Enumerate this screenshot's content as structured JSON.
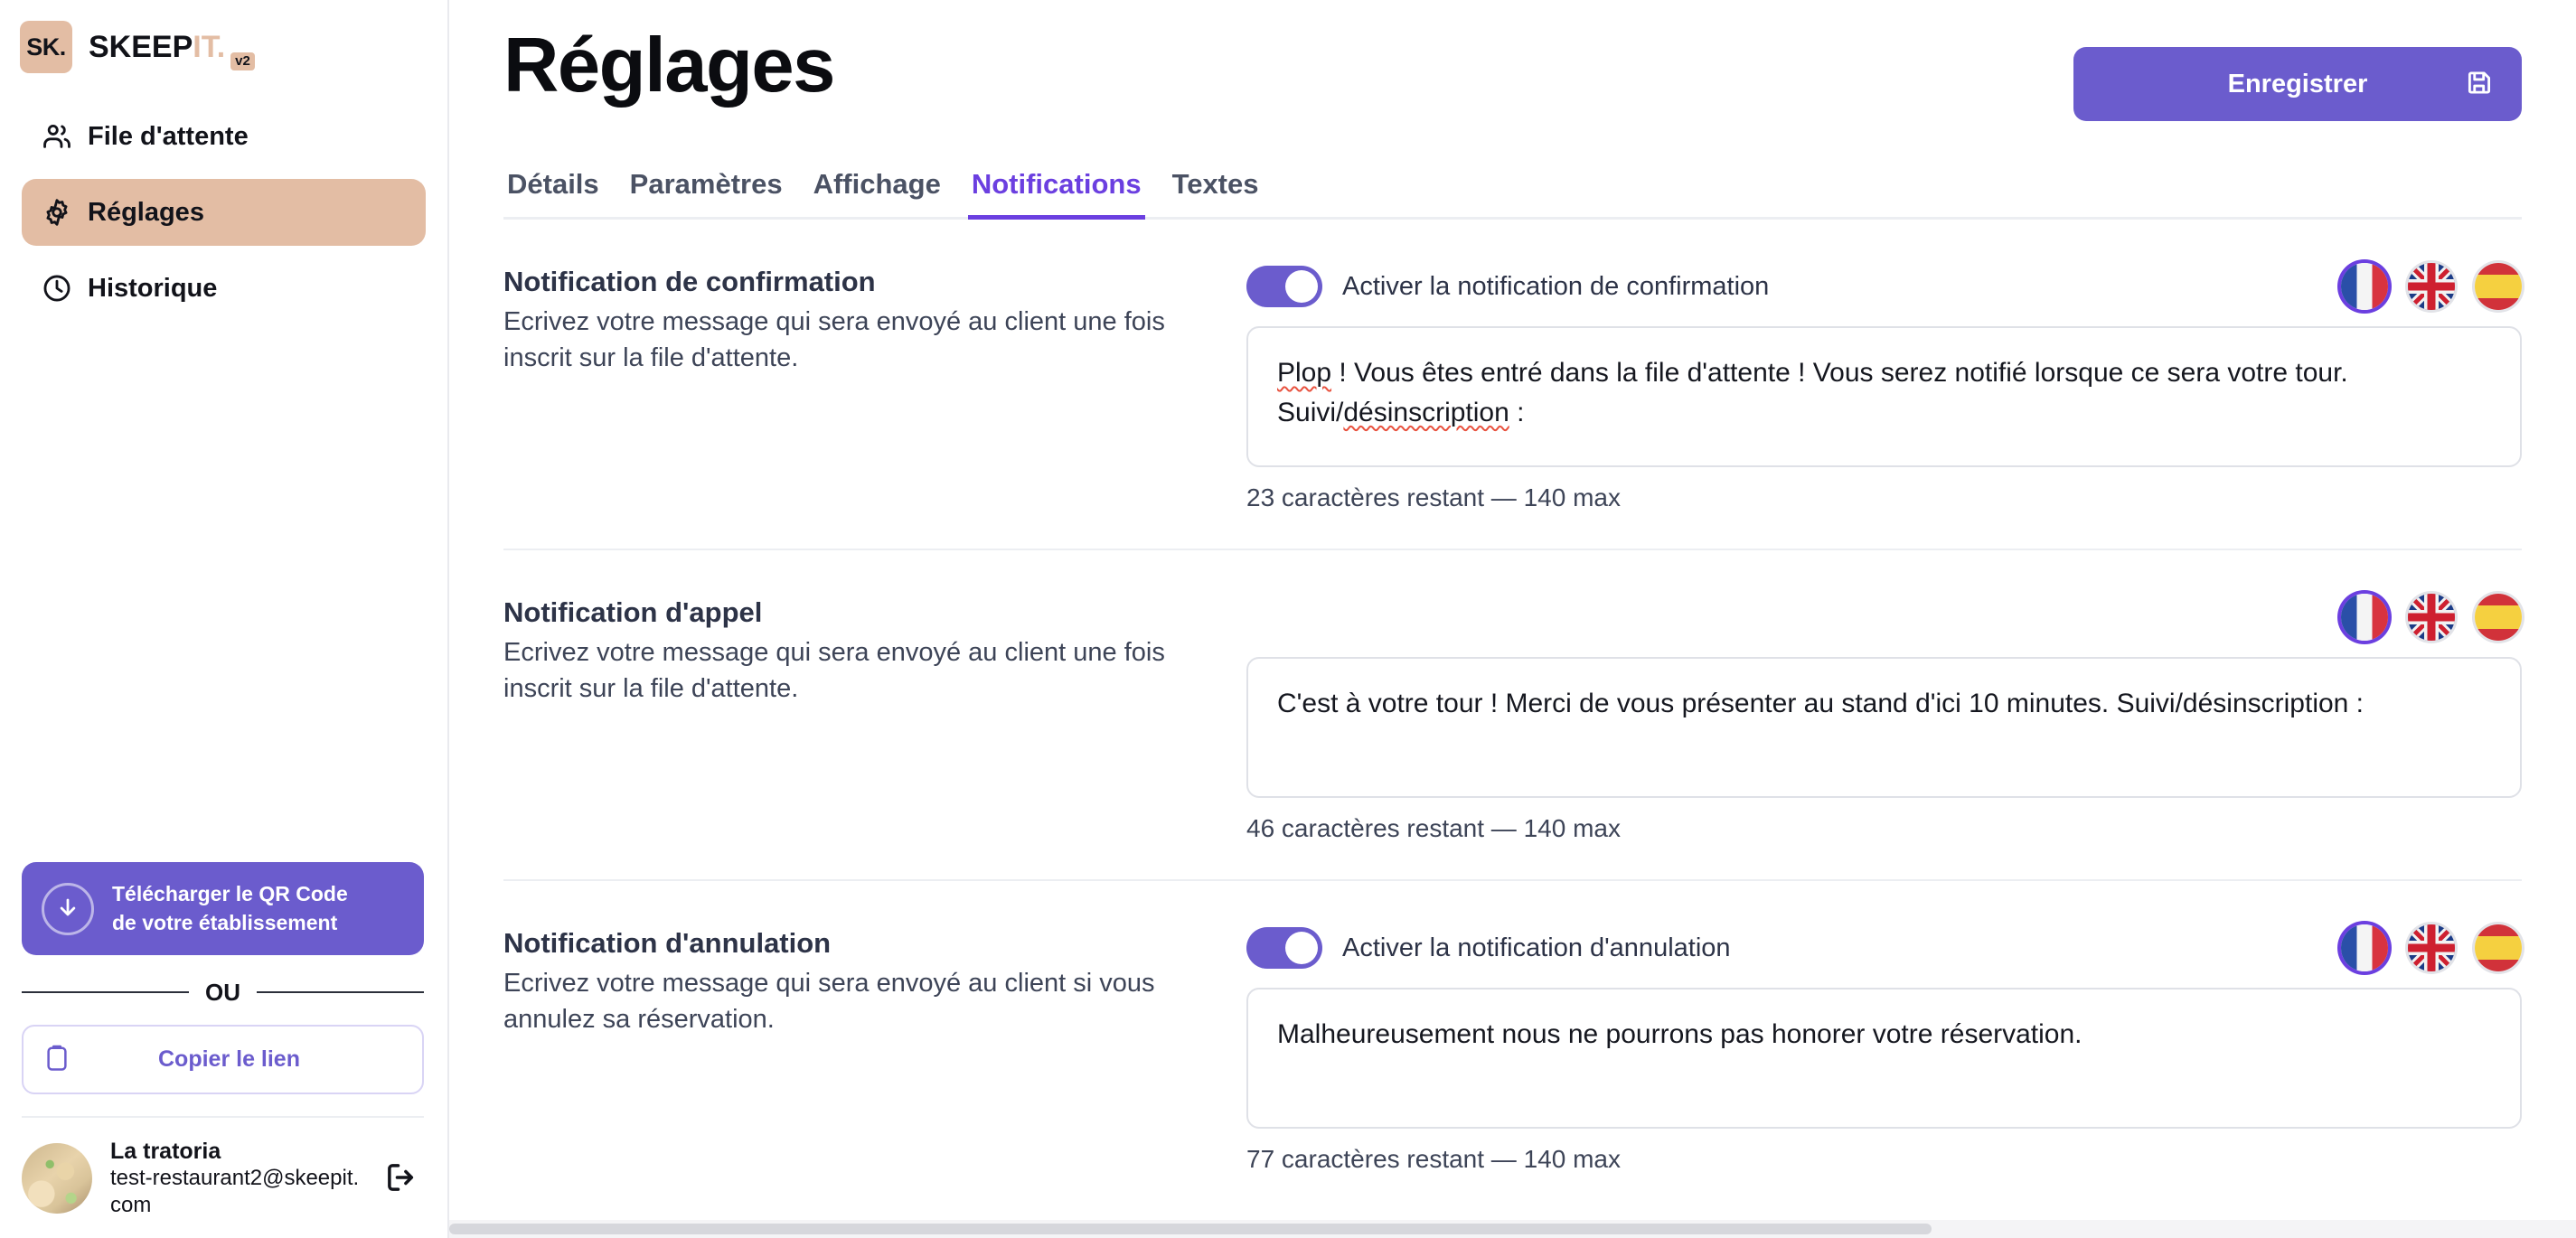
{
  "brand": {
    "mark": "SK.",
    "word_main": "SKEEP",
    "word_accent": "IT.",
    "version_badge": "v2",
    "accent_color": "#e3bda4",
    "primary_color": "#6b5ccd",
    "active_tab_color": "#6b3fe0"
  },
  "sidebar": {
    "items": [
      {
        "label": "File d'attente",
        "icon": "users-icon",
        "active": false
      },
      {
        "label": "Réglages",
        "icon": "gear-icon",
        "active": true
      },
      {
        "label": "Historique",
        "icon": "clock-icon",
        "active": false
      }
    ],
    "qr_button": {
      "line1": "Télécharger le QR Code",
      "line2": "de votre établissement",
      "icon": "download-circle-icon"
    },
    "divider_text": "OU",
    "copy_button": {
      "label": "Copier le lien",
      "icon": "clipboard-icon"
    },
    "account": {
      "name": "La tratoria",
      "email": "test-restaurant2@skeepit.com",
      "logout_icon": "logout-icon",
      "avatar": "avatar-pizza-photo"
    }
  },
  "header": {
    "title": "Réglages",
    "save_button": {
      "label": "Enregistrer",
      "icon": "save-disk-icon"
    }
  },
  "tabs": [
    {
      "label": "Détails",
      "active": false
    },
    {
      "label": "Paramètres",
      "active": false
    },
    {
      "label": "Affichage",
      "active": false
    },
    {
      "label": "Notifications",
      "active": true
    },
    {
      "label": "Textes",
      "active": false
    }
  ],
  "languages": [
    {
      "code": "fr",
      "name": "Français",
      "selected": true
    },
    {
      "code": "gb",
      "name": "English",
      "selected": false
    },
    {
      "code": "es",
      "name": "Español",
      "selected": false
    }
  ],
  "notifications": [
    {
      "title": "Notification de confirmation",
      "description": "Ecrivez votre message qui sera envoyé au client une fois inscrit sur la file d'attente.",
      "has_toggle": true,
      "toggle_on": true,
      "toggle_label": "Activer la notification de confirmation",
      "message_part1": "Plop",
      "message_part2": " ! Vous êtes entré dans la file d'attente ! Vous serez notifié lorsque ce sera votre tour. Suivi/",
      "message_part3": "désinscription",
      "message_part4": " :",
      "counter": "23 caractères restant — 140 max"
    },
    {
      "title": "Notification d'appel",
      "description": "Ecrivez votre message qui sera envoyé au client une fois inscrit sur la file d'attente.",
      "has_toggle": false,
      "toggle_on": false,
      "toggle_label": "",
      "message_part1": "",
      "message_part2": "C'est à votre tour ! Merci de vous présenter au stand d'ici 10 minutes. Suivi/désinscription :",
      "message_part3": "",
      "message_part4": "",
      "counter": "46 caractères restant — 140 max"
    },
    {
      "title": "Notification d'annulation",
      "description": "Ecrivez votre message qui sera envoyé au client si vous annulez sa réservation.",
      "has_toggle": true,
      "toggle_on": true,
      "toggle_label": "Activer la notification d'annulation",
      "message_part1": "",
      "message_part2": "Malheureusement nous ne pourrons pas honorer votre réservation.",
      "message_part3": "",
      "message_part4": "",
      "counter": "77 caractères restant — 140 max"
    }
  ]
}
